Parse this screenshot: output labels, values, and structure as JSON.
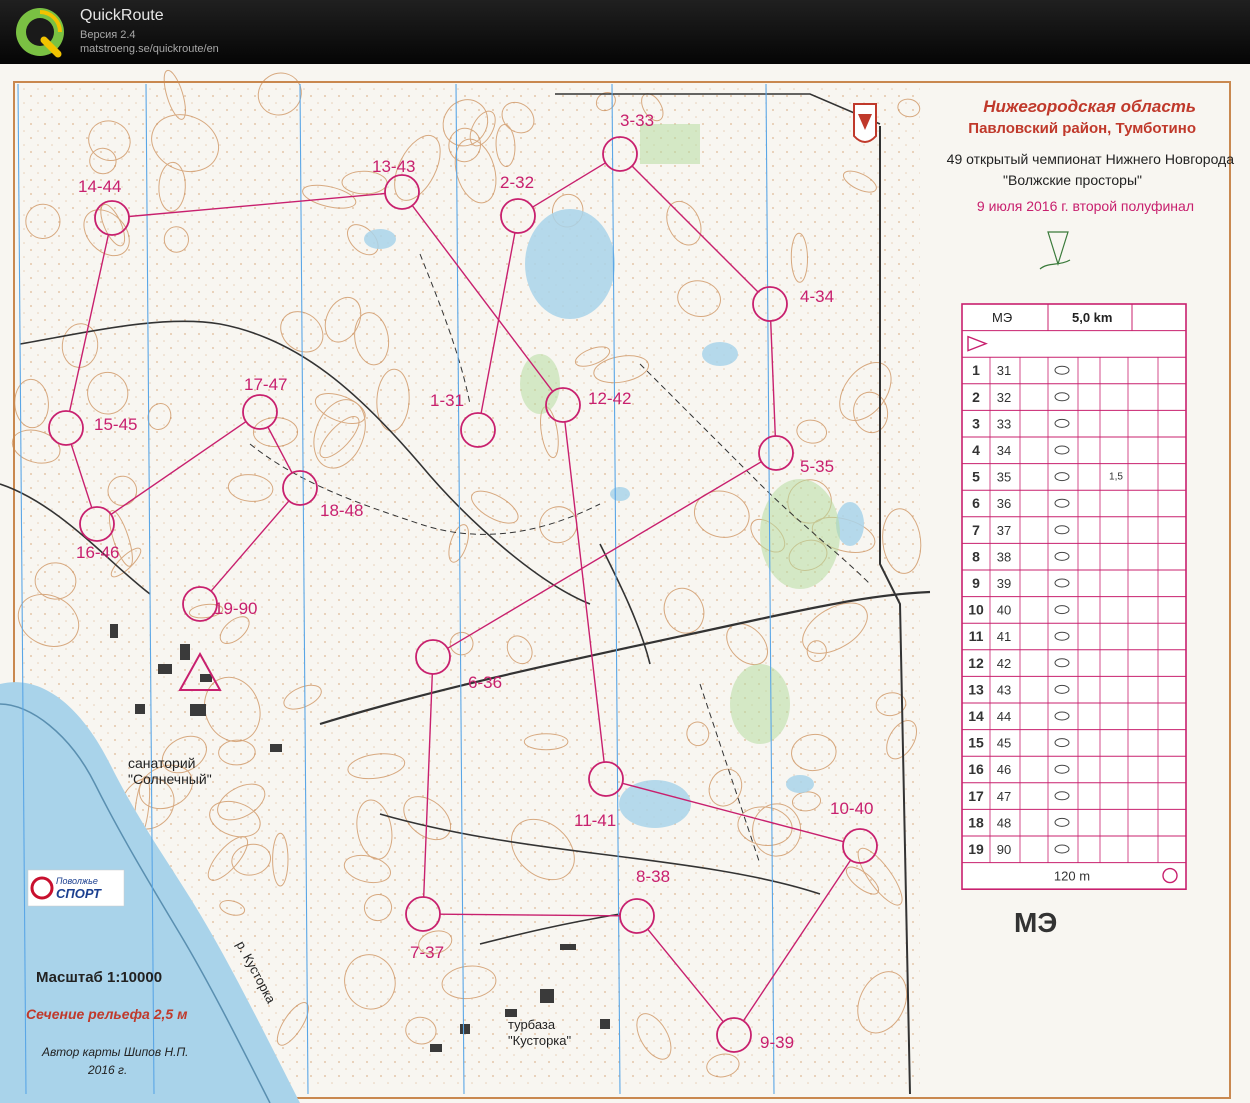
{
  "app": {
    "name": "QuickRoute",
    "version": "Версия 2.4",
    "url": "matstroeng.se/quickroute/en"
  },
  "map": {
    "region": "Нижегородская область",
    "district": "Павловский район, Тумботино",
    "event": "49 открытый чемпионат Нижнего Новгорода",
    "event_name": "\"Волжские просторы\"",
    "date": "9 июля 2016 г. второй полуфинал",
    "class_big": "МЭ",
    "scale": "Масштаб 1:10000",
    "contour": "Сечение рельефа 2,5 м",
    "author": "Автор карты  Шипов Н.П.",
    "year": "2016 г.",
    "sanatorium": "санаторий",
    "sanatorium_name": "\"Солнечный\"",
    "base": "турбаза",
    "base_name": "\"Кусторка\"",
    "river": "р. Кусторка",
    "sponsor_top": "Поволжье",
    "sponsor_bottom": "СПОРТ"
  },
  "controls": [
    {
      "label": "3-33"
    },
    {
      "label": "2-32"
    },
    {
      "label": "13-43"
    },
    {
      "label": "14-44"
    },
    {
      "label": "4-34"
    },
    {
      "label": "15-45"
    },
    {
      "label": "17-47"
    },
    {
      "label": "18-48"
    },
    {
      "label": "16-46"
    },
    {
      "label": "19-90"
    },
    {
      "label": "1-31"
    },
    {
      "label": "12-42"
    },
    {
      "label": "5-35"
    },
    {
      "label": "6-36"
    },
    {
      "label": "11-41"
    },
    {
      "label": "10-40"
    },
    {
      "label": "8-38"
    },
    {
      "label": "7-37"
    },
    {
      "label": "9-39"
    }
  ],
  "description_sheet": {
    "class": "МЭ",
    "length": "5,0 km",
    "finish_distance": "120 m",
    "rows": [
      {
        "num": "1",
        "code": "31",
        "extra": ""
      },
      {
        "num": "2",
        "code": "32",
        "extra": ""
      },
      {
        "num": "3",
        "code": "33",
        "extra": ""
      },
      {
        "num": "4",
        "code": "34",
        "extra": ""
      },
      {
        "num": "5",
        "code": "35",
        "extra": "1,5"
      },
      {
        "num": "6",
        "code": "36",
        "extra": ""
      },
      {
        "num": "7",
        "code": "37",
        "extra": ""
      },
      {
        "num": "8",
        "code": "38",
        "extra": ""
      },
      {
        "num": "9",
        "code": "39",
        "extra": ""
      },
      {
        "num": "10",
        "code": "40",
        "extra": ""
      },
      {
        "num": "11",
        "code": "41",
        "extra": ""
      },
      {
        "num": "12",
        "code": "42",
        "extra": ""
      },
      {
        "num": "13",
        "code": "43",
        "extra": ""
      },
      {
        "num": "14",
        "code": "44",
        "extra": ""
      },
      {
        "num": "15",
        "code": "45",
        "extra": ""
      },
      {
        "num": "16",
        "code": "46",
        "extra": ""
      },
      {
        "num": "17",
        "code": "47",
        "extra": ""
      },
      {
        "num": "18",
        "code": "48",
        "extra": ""
      },
      {
        "num": "19",
        "code": "90",
        "extra": ""
      }
    ]
  },
  "colors": {
    "course": "#c8206e",
    "contour": "#c9884f",
    "water": "#a9d3ea",
    "north_lines": "#5aa6e6",
    "paper": "#f7f5ef"
  }
}
